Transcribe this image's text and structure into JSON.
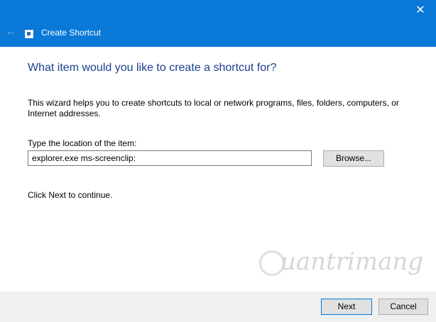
{
  "window": {
    "title": "Create Shortcut",
    "close_glyph": "✕",
    "back_glyph": "←",
    "accent_color": "#0a78d7"
  },
  "page": {
    "heading": "What item would you like to create a shortcut for?",
    "description": "This wizard helps you to create shortcuts to local or network programs, files, folders, computers, or Internet addresses.",
    "location_label": "Type the location of the item:",
    "location_value": "explorer.exe ms-screenclip:",
    "browse_label": "Browse...",
    "hint": "Click Next to continue."
  },
  "watermark": {
    "text": "uantrimang"
  },
  "footer": {
    "next_label": "Next",
    "cancel_label": "Cancel"
  }
}
